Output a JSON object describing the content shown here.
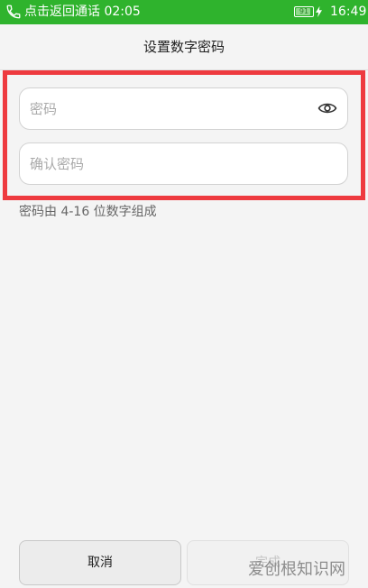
{
  "status_bar": {
    "call_text": "点击返回通话 02:05",
    "battery_level": "91",
    "time": "16:49",
    "background_color": "#2fb32d",
    "icons": [
      "phone-icon",
      "battery-icon",
      "charging-bolt-icon"
    ]
  },
  "header": {
    "title": "设置数字密码"
  },
  "form": {
    "password_placeholder": "密码",
    "confirm_placeholder": "确认密码",
    "hint": "密码由 4-16 位数字组成",
    "highlight_color": "#ee3a3f",
    "toggle_icon": "eye-icon"
  },
  "footer": {
    "cancel_label": "取消",
    "done_label": "完成",
    "done_enabled": false
  },
  "watermark": {
    "text": "爱创根知识网"
  }
}
